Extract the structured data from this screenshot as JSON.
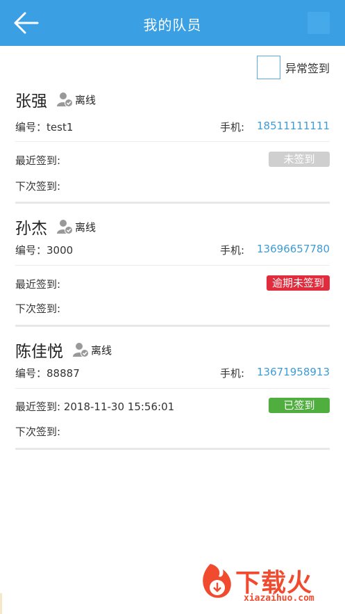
{
  "header": {
    "title": "我的队员",
    "back_icon": "arrow-left-icon"
  },
  "filter": {
    "label": "异常签到",
    "checked": false
  },
  "labels": {
    "id_prefix": "编号：",
    "phone_prefix": "手机:",
    "last_checkin": "最近签到:",
    "next_checkin": "下次签到:"
  },
  "members": [
    {
      "name": "张强",
      "status": "离线",
      "id": "test1",
      "phone": "18511111111",
      "last_checkin": "",
      "next_checkin": "",
      "badge": "未签到",
      "badge_color": "#cfcfcf"
    },
    {
      "name": "孙杰",
      "status": "离线",
      "id": "3000",
      "phone": "13696657780",
      "last_checkin": "",
      "next_checkin": "",
      "badge": "逾期未签到",
      "badge_color": "#e02c3c"
    },
    {
      "name": "陈佳悦",
      "status": "离线",
      "id": "88887",
      "phone": "13671958913",
      "last_checkin": "2018-11-30 15:56:01",
      "next_checkin": "",
      "badge": "已签到",
      "badge_color": "#4fae3d"
    }
  ],
  "watermark": {
    "text": "下载火",
    "sub": "xiazaihuo.com"
  },
  "colors": {
    "accent": "#3aa0e3",
    "link": "#3d9bd6"
  }
}
